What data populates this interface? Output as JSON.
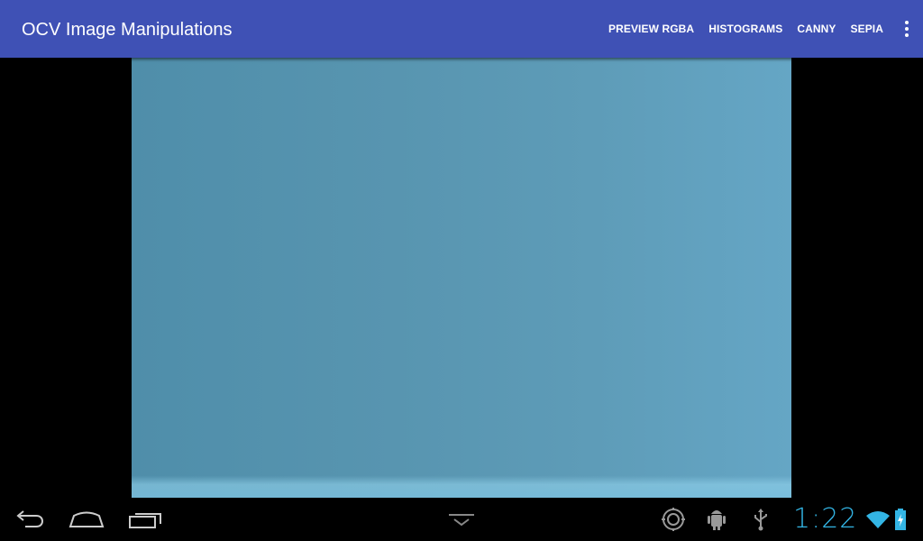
{
  "app_bar": {
    "title": "OCV Image Manipulations",
    "actions": [
      "PREVIEW RGBA",
      "HISTOGRAMS",
      "CANNY",
      "SEPIA"
    ],
    "overflow_icon": "more-vert-icon",
    "color": "#3f51b5"
  },
  "camera_view": {
    "content": "camera-preview",
    "color": "#5a98b4"
  },
  "nav_bar": {
    "buttons": [
      "back-icon",
      "home-icon",
      "recent-apps-icon",
      "hide-keyboard-icon"
    ],
    "status_icons": [
      "screenshot-icon",
      "android-debug-icon",
      "usb-icon",
      "wifi-icon",
      "battery-charging-icon"
    ],
    "clock": "1:22",
    "accent": "#33b5e5"
  }
}
